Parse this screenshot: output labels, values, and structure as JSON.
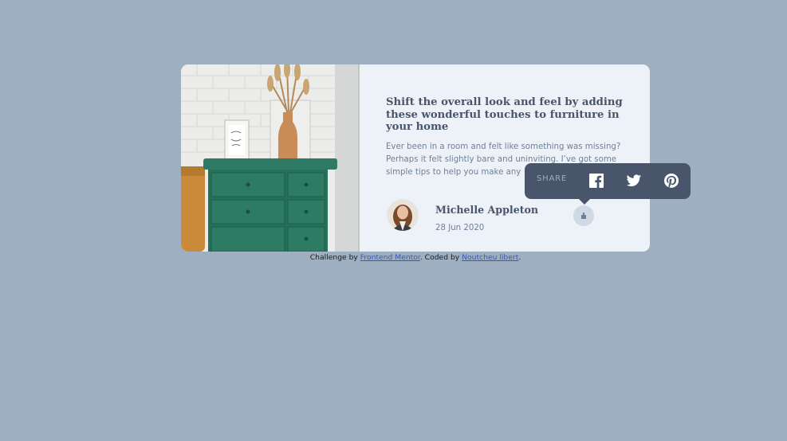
{
  "article": {
    "headline": "Shift the overall look and feel by adding these wonderful touches to furniture in your home",
    "body": "Ever been in a room and felt like something was missing? Perhaps it felt slightly bare and uninviting. I’ve got some simple tips to help you make any"
  },
  "author": {
    "name": "Michelle Appleton",
    "date": "28 Jun 2020"
  },
  "share": {
    "label": "SHARE",
    "icons": [
      "facebook-icon",
      "twitter-icon",
      "pinterest-icon"
    ]
  },
  "footer": {
    "prefix": "Challenge by",
    "challenge_link": "Frontend Mentor",
    "middle": ". Coded by",
    "coder_link": "Noutcheu libert",
    "suffix": "."
  },
  "colors": {
    "background": "#9eafc2",
    "card": "#ecf2f8",
    "dark_text": "#48556a",
    "muted_text": "#6e8098",
    "popup": "#48556a"
  }
}
